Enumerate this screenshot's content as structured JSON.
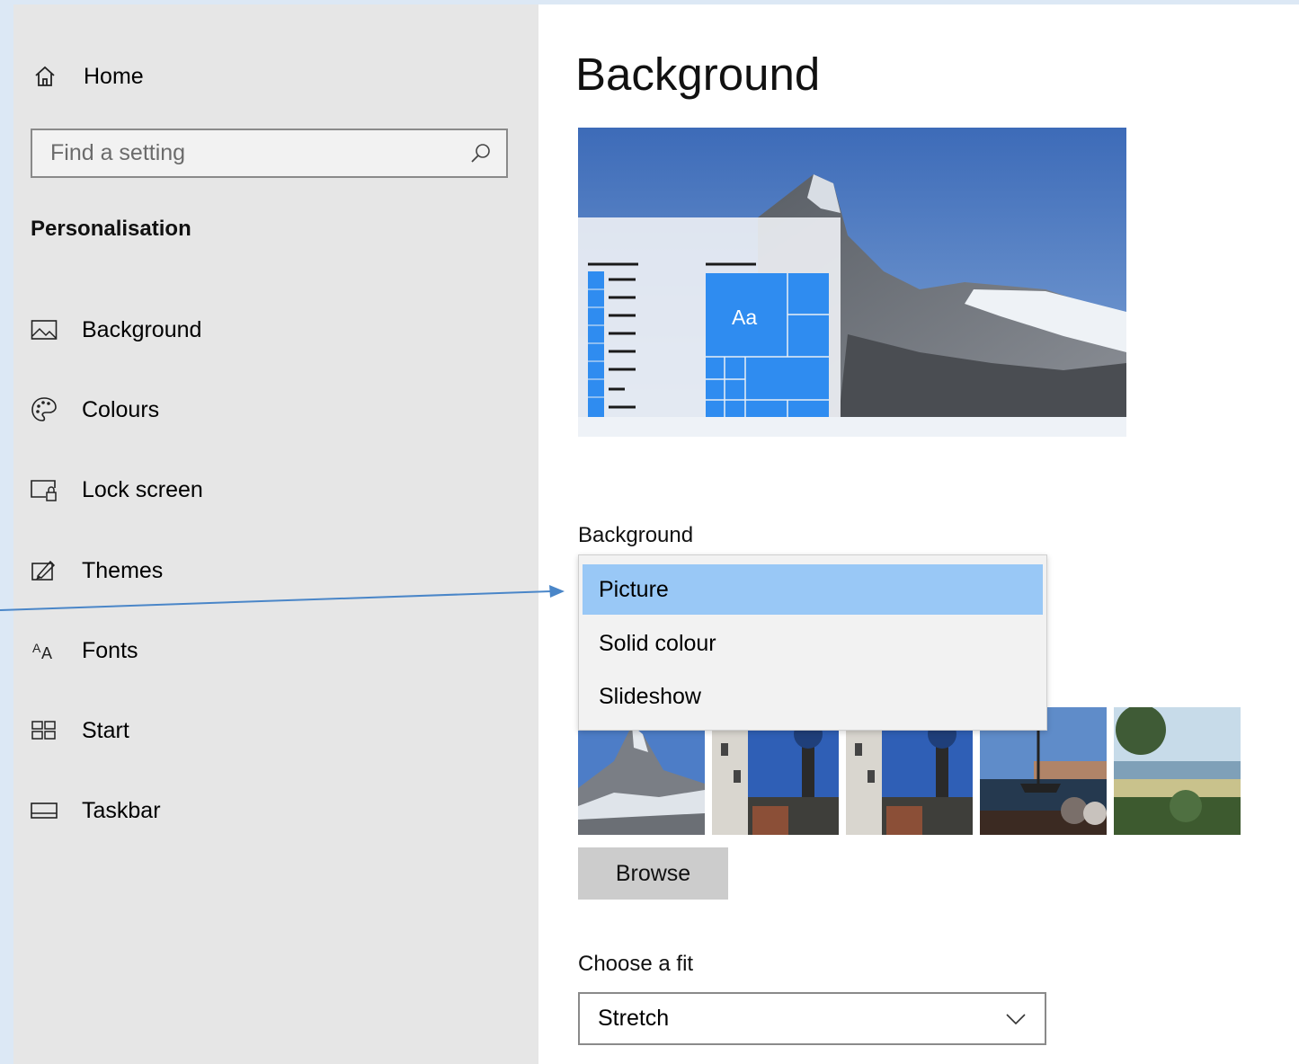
{
  "sidebar": {
    "home_label": "Home",
    "search_placeholder": "Find a setting",
    "section_title": "Personalisation",
    "items": [
      {
        "label": "Background",
        "icon": "picture-icon"
      },
      {
        "label": "Colours",
        "icon": "palette-icon"
      },
      {
        "label": "Lock screen",
        "icon": "lock-screen-icon"
      },
      {
        "label": "Themes",
        "icon": "themes-icon"
      },
      {
        "label": "Fonts",
        "icon": "fonts-icon"
      },
      {
        "label": "Start",
        "icon": "start-icon"
      },
      {
        "label": "Taskbar",
        "icon": "taskbar-icon"
      }
    ]
  },
  "main": {
    "title": "Background",
    "preview_tile_text": "Aa",
    "background_label": "Background",
    "background_options": [
      "Picture",
      "Solid colour",
      "Slideshow"
    ],
    "background_selected": "Picture",
    "browse_label": "Browse",
    "fit_label": "Choose a fit",
    "fit_value": "Stretch"
  },
  "colors": {
    "accent": "#2f8cf0",
    "selected_option": "#99c8f6",
    "annotation_arrow": "#4a86c8"
  }
}
